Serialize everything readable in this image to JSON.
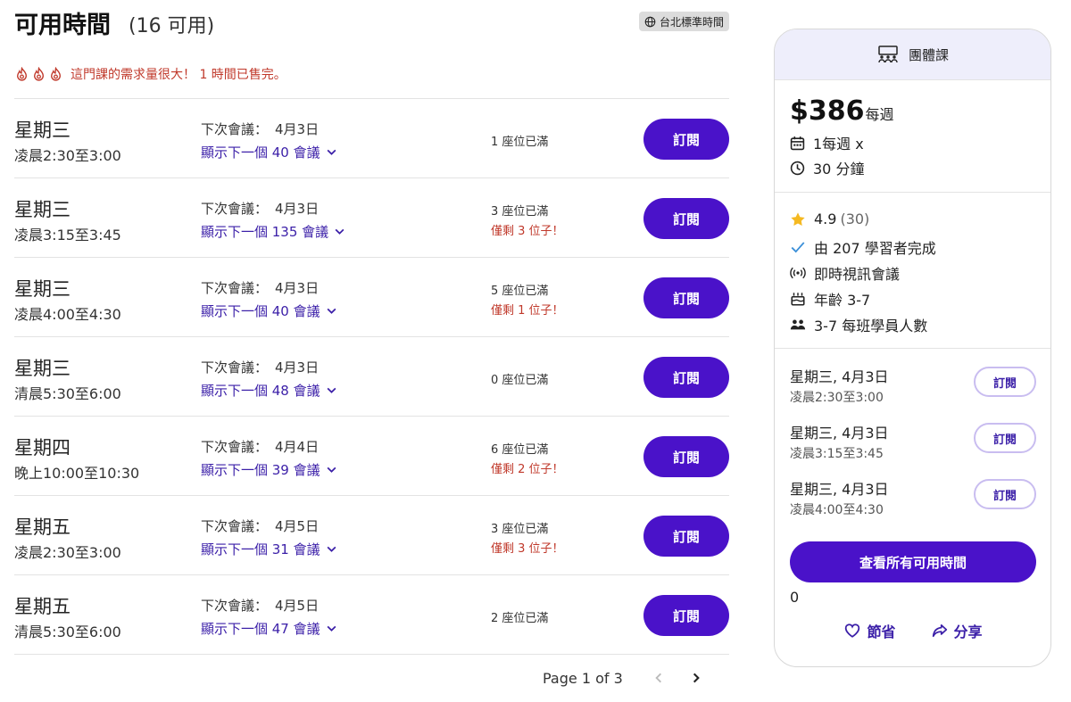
{
  "header": {
    "title": "可用時間",
    "count": "(16 可用)",
    "timezone": "台北標準時間"
  },
  "alert": {
    "text": "這門課的需求量很大！ 1 時間已售完。",
    "color": "#c0392b",
    "flame_count": 3
  },
  "colors": {
    "primary": "#4a12c9",
    "link": "#3b1fa8",
    "warning": "#c0392b"
  },
  "rows": [
    {
      "day": "星期三",
      "time": "凌晨2:30至3:00",
      "next_label": "下次會議：",
      "next_date": "4月3日",
      "more": "顯示下一個 40 會議",
      "seats": "1 座位已滿",
      "spots_left": "",
      "button": "訂閱"
    },
    {
      "day": "星期三",
      "time": "凌晨3:15至3:45",
      "next_label": "下次會議：",
      "next_date": "4月3日",
      "more": "顯示下一個 135 會議",
      "seats": "3 座位已滿",
      "spots_left": "僅剩 3 位子！",
      "button": "訂閱"
    },
    {
      "day": "星期三",
      "time": "凌晨4:00至4:30",
      "next_label": "下次會議：",
      "next_date": "4月3日",
      "more": "顯示下一個 40 會議",
      "seats": "5 座位已滿",
      "spots_left": "僅剩 1 位子！",
      "button": "訂閱"
    },
    {
      "day": "星期三",
      "time": "清晨5:30至6:00",
      "next_label": "下次會議：",
      "next_date": "4月3日",
      "more": "顯示下一個 48 會議",
      "seats": "0 座位已滿",
      "spots_left": "",
      "button": "訂閱"
    },
    {
      "day": "星期四",
      "time": "晚上10:00至10:30",
      "next_label": "下次會議：",
      "next_date": "4月4日",
      "more": "顯示下一個 39 會議",
      "seats": "6 座位已滿",
      "spots_left": "僅剩 2 位子！",
      "button": "訂閱"
    },
    {
      "day": "星期五",
      "time": "凌晨2:30至3:00",
      "next_label": "下次會議：",
      "next_date": "4月5日",
      "more": "顯示下一個 31 會議",
      "seats": "3 座位已滿",
      "spots_left": "僅剩 3 位子！",
      "button": "訂閱"
    },
    {
      "day": "星期五",
      "time": "清晨5:30至6:00",
      "next_label": "下次會議：",
      "next_date": "4月5日",
      "more": "顯示下一個 47 會議",
      "seats": "2 座位已滿",
      "spots_left": "",
      "button": "訂閱"
    }
  ],
  "pagination": {
    "text": "Page 1 of 3"
  },
  "card": {
    "header": "團體課",
    "price": "$386",
    "price_unit": "每週",
    "frequency": "1每週 x",
    "duration": "30 分鐘",
    "rating": "4.9",
    "rating_count": "(30)",
    "completed": "由 207 學習者完成",
    "format": "即時視訊會議",
    "age": "年齡 3-7",
    "class_size": "3-7 每班學員人數",
    "sessions": [
      {
        "date": "星期三, 4月3日",
        "time": "凌晨2:30至3:00",
        "button": "訂閱"
      },
      {
        "date": "星期三, 4月3日",
        "time": "凌晨3:15至3:45",
        "button": "訂閱"
      },
      {
        "date": "星期三, 4月3日",
        "time": "凌晨4:00至4:30",
        "button": "訂閱"
      }
    ],
    "all_times_button": "查看所有可用時間",
    "zero": "0",
    "save_label": "節省",
    "share_label": "分享"
  }
}
